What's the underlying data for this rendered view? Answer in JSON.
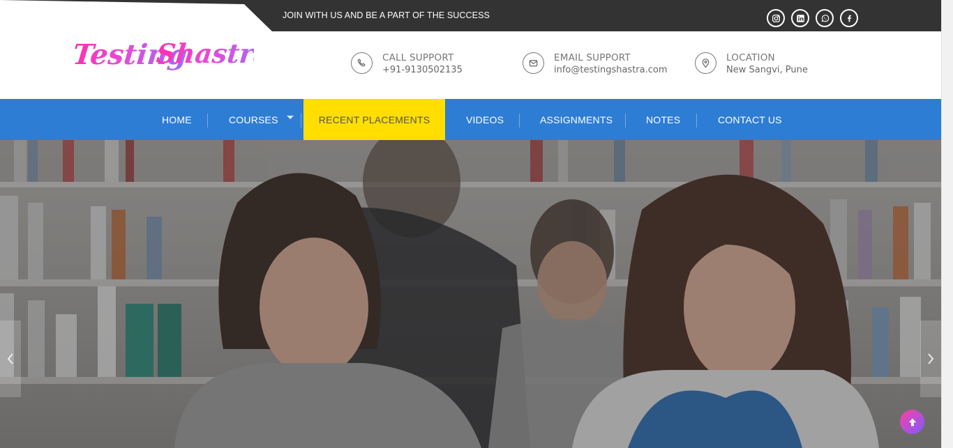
{
  "topbar": {
    "tagline": "JOIN WITH US AND BE A PART OF THE SUCCESS",
    "social": [
      {
        "icon": "instagram-icon"
      },
      {
        "icon": "linkedin-icon"
      },
      {
        "icon": "whatsapp-icon"
      },
      {
        "icon": "facebook-icon"
      }
    ]
  },
  "header": {
    "logo_text_part1": "Testing",
    "logo_text_part2": "Shastra",
    "call": {
      "title": "CALL SUPPORT",
      "value": "+91-9130502135"
    },
    "email": {
      "title": "EMAIL SUPPORT",
      "value": "info@testingshastra.com"
    },
    "location": {
      "title": "LOCATION",
      "value": "New Sangvi, Pune"
    }
  },
  "nav": {
    "items": [
      {
        "label": "HOME"
      },
      {
        "label": "COURSES"
      },
      {
        "label": "RECENT PLACEMENTS"
      },
      {
        "label": "VIDEOS"
      },
      {
        "label": "ASSIGNMENTS"
      },
      {
        "label": "NOTES"
      },
      {
        "label": "CONTACT US"
      }
    ],
    "active_index": 2
  },
  "colors": {
    "nav_bg": "#2e7dd4",
    "active_bg": "#ffde00",
    "topbar_bg": "#333333",
    "logo_gradient_start": "#ff2fb0",
    "logo_gradient_end": "#9a5cff"
  }
}
